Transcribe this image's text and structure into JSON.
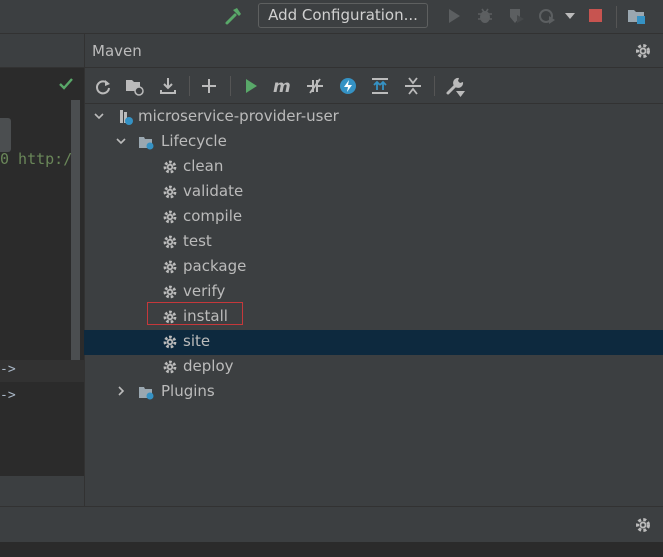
{
  "toolbar": {
    "add_configuration_label": "Add Configuration...",
    "icons": [
      "build-hammer-icon",
      "run-icon",
      "debug-icon",
      "coverage-icon",
      "profile-icon",
      "run-dropdown-icon",
      "stop-icon",
      "project-structure-icon"
    ]
  },
  "editor": {
    "code_line": "0 http:/",
    "arrow_1": "->",
    "arrow_2": "->"
  },
  "maven": {
    "title": "Maven",
    "toolbar_icons": [
      "reload-icon",
      "generate-sources-icon",
      "download-icon",
      "add-icon",
      "run-maven-build-icon",
      "execute-goal-icon",
      "toggle-offline-icon",
      "skip-tests-icon",
      "show-dependencies-icon",
      "collapse-all-icon",
      "settings-wrench-icon"
    ],
    "tree": {
      "project": "microservice-provider-user",
      "lifecycle_label": "Lifecycle",
      "lifecycle": [
        "clean",
        "validate",
        "compile",
        "test",
        "package",
        "verify",
        "install",
        "site",
        "deploy"
      ],
      "plugins_label": "Plugins",
      "selected": "site",
      "highlighted": "install"
    }
  },
  "colors": {
    "accent_green": "#59a869",
    "stop_red": "#c75450",
    "selection": "#0d293e",
    "highlight_box": "#c5383b"
  }
}
